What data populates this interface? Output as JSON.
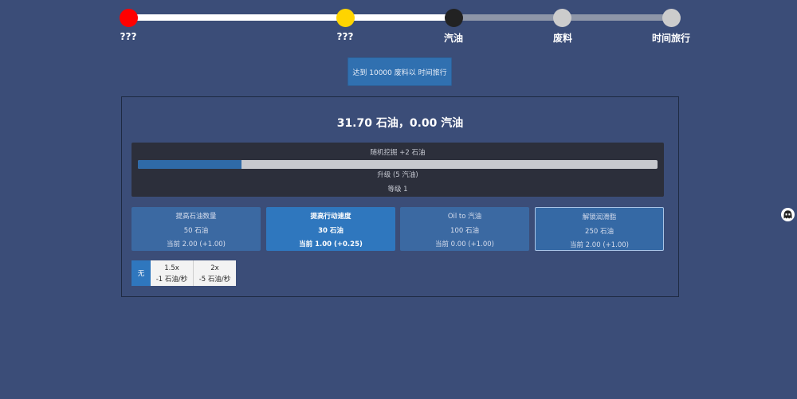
{
  "track": {
    "stages": [
      {
        "label": "???",
        "status": "done",
        "color": "#ff0000"
      },
      {
        "label": "???",
        "status": "done",
        "color": "#ffd400"
      },
      {
        "label": "汽油",
        "status": "current",
        "color": "#222222"
      },
      {
        "label": "废料",
        "status": "locked",
        "color": "#cccccc"
      },
      {
        "label": "时间旅行",
        "status": "locked",
        "color": "#cccccc"
      }
    ]
  },
  "goal": {
    "text": "达到 10000 废料以 时间旅行"
  },
  "resources": {
    "text": "31.70 石油，0.00 汽油"
  },
  "dig": {
    "title": "随机挖掘 +2 石油",
    "progress": 0.2,
    "upgrade": "升级 (5 汽油)",
    "level": "等级 1"
  },
  "upgrades": [
    {
      "name": "提高石油数量",
      "cost": "50 石油",
      "current": "当前 2.00 (+1.00)",
      "state": "dim"
    },
    {
      "name": "提高行动速度",
      "cost": "30 石油",
      "current": "当前 1.00 (+0.25)",
      "state": "bright"
    },
    {
      "name": "Oil to 汽油",
      "cost": "100 石油",
      "current": "当前 0.00 (+1.00)",
      "state": "dim"
    },
    {
      "name": "解锁润滑脂",
      "cost": "250 石油",
      "current": "当前 2.00 (+1.00)",
      "state": "selected"
    }
  ],
  "speed": {
    "none_label": "无",
    "options": [
      {
        "mult": "1.5x",
        "cost": "-1 石油/秒"
      },
      {
        "mult": "2x",
        "cost": "-5 石油/秒"
      }
    ]
  },
  "colors": {
    "background": "#3b4d78",
    "accent": "#2f77be",
    "track_done": "#ffffff",
    "track_locked": "#8e96a8"
  },
  "icons": {
    "avatar": "ghost-face-icon"
  }
}
